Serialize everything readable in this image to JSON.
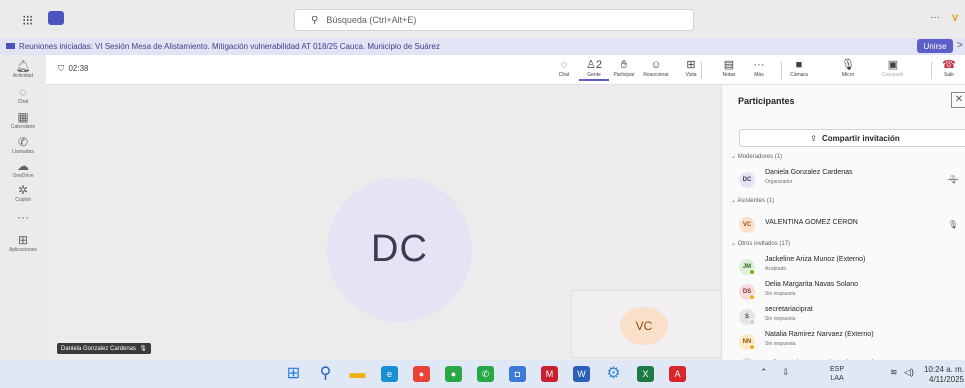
{
  "titlebar": {
    "search_placeholder": "Búsqueda (Ctrl+Alt+E)",
    "more": "···",
    "avatar_initials": "V"
  },
  "banner": {
    "text": "Reuniones iniciadas: VI Sesión Mesa de Alistamiento. Mitigación vulnerabilidad AT 018/25 Cauca. Municipio de Suárez",
    "join_label": "Unirse",
    "close": ">"
  },
  "rail": [
    {
      "icon": "bell-icon",
      "glyph": "🔔︎",
      "label": "Actividad"
    },
    {
      "icon": "chat-icon",
      "glyph": "◌",
      "label": "Chat"
    },
    {
      "icon": "calendar-icon",
      "glyph": "▦",
      "label": "Calendario"
    },
    {
      "icon": "phone-icon",
      "glyph": "✆",
      "label": "Llamadas"
    },
    {
      "icon": "cloud-icon",
      "glyph": "☁",
      "label": "OneDrive"
    },
    {
      "icon": "copilot-icon",
      "glyph": "✲",
      "label": "Copilot"
    },
    {
      "icon": "more-icon",
      "glyph": "···",
      "label": ""
    },
    {
      "icon": "add-apps-icon",
      "glyph": "⊞",
      "label": "Aplicaciones"
    }
  ],
  "meeting": {
    "timer": "02:38",
    "toolbar": [
      {
        "icon": "chat-icon",
        "glyph": "◌",
        "label": "Chat"
      },
      {
        "icon": "people-icon",
        "glyph": "♙2",
        "label": "Gente"
      },
      {
        "icon": "raise-hand-icon",
        "glyph": "✋︎",
        "label": "Participar"
      },
      {
        "icon": "react-icon",
        "glyph": "☺",
        "label": "Reaccionar"
      },
      {
        "icon": "view-icon",
        "glyph": "⊞",
        "label": "Vista"
      },
      {
        "icon": "notes-icon",
        "glyph": "▤",
        "label": "Notas"
      },
      {
        "icon": "more-icon",
        "glyph": "···",
        "label": "Más"
      },
      {
        "icon": "camera-off-icon",
        "glyph": "■",
        "label": "Cámara"
      },
      {
        "icon": "mic-icon",
        "glyph": "🎙︎",
        "label": "Micro"
      },
      {
        "icon": "share-icon",
        "glyph": "▣",
        "label": "Compartir"
      },
      {
        "icon": "hang-up-icon",
        "glyph": "☎",
        "label": "Salir"
      }
    ],
    "speaker_initials": "DC",
    "speaker_name": "Daniela Gonzalez Cardenas",
    "self_initials": "VC"
  },
  "participants": {
    "title": "Participantes",
    "invite_label": "Compartir invitación",
    "groups": [
      {
        "label": "Moderadores (1)"
      },
      {
        "label": "Asistentes (1)"
      },
      {
        "label": "Otros invitados (17)"
      }
    ],
    "people": [
      {
        "initials": "DC",
        "name": "Daniela Gonzalez Cardenas",
        "sub": "Organizador",
        "color": "#e6e3f5",
        "fg": "#3b3b54"
      },
      {
        "initials": "VC",
        "name": "VALENTINA GOMEZ CERON",
        "sub": "",
        "color": "#fde1cc",
        "fg": "#9a4a10"
      },
      {
        "initials": "JM",
        "name": "Jackeline Ariza Munoz (Externo)",
        "sub": "Aceptado",
        "color": "#dcefd8",
        "fg": "#2d6b22"
      },
      {
        "initials": "DS",
        "name": "Delia Margarita Navas Solano",
        "sub": "Sin respuesta",
        "color": "#f6dcdc",
        "fg": "#8a2b2b"
      },
      {
        "initials": "S",
        "name": "secretariaciprat",
        "sub": "Sin respuesta",
        "color": "#e5e5e5",
        "fg": "#444444"
      },
      {
        "initials": "NN",
        "name": "Natalia Ramirez Narvaez (Externo)",
        "sub": "Sin respuesta",
        "color": "#fbe9c9",
        "fg": "#8a5a00"
      },
      {
        "initials": "YL",
        "name": "Yuliet Paola Lopez Sierra (Externo)",
        "sub": "",
        "color": "#e8dcf0",
        "fg": "#5b2e7a"
      }
    ]
  },
  "taskbar": {
    "lang": "ESP",
    "lang_sub": "LAA",
    "time": "10:24 a. m.",
    "date": "4/11/2025"
  }
}
